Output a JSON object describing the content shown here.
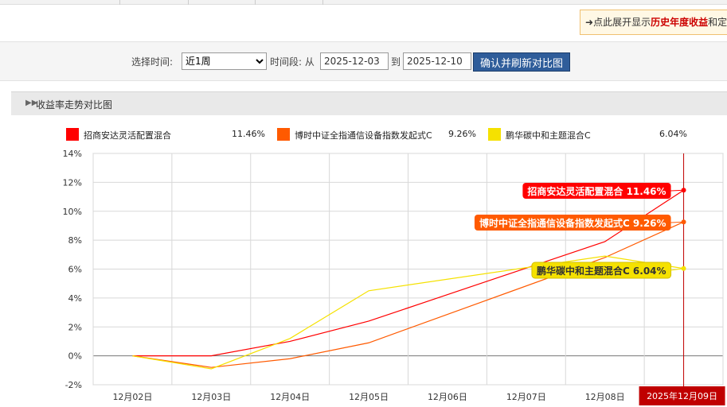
{
  "hint": {
    "text": "点此展开显示",
    "emph": "历史年度收益",
    "tail": "和定"
  },
  "filter": {
    "time_label": "选择时间:",
    "period_selected": "近1周",
    "range_label": "时间段: 从",
    "start_date": "2025-12-03",
    "to_label": "到",
    "end_date": "2025-12-10",
    "confirm_label": "确认并刷新对比图"
  },
  "section": {
    "title": "收益率走势对比图"
  },
  "legend": [
    {
      "name": "招商安达灵活配置混合",
      "value": "11.46%",
      "color": "#ff0000"
    },
    {
      "name": "博时中证全指通信设备指数发起式C",
      "value": "9.26%",
      "color": "#ff5a00"
    },
    {
      "name": "鹏华碳中和主题混合C",
      "value": "6.04%",
      "color": "#f5e100"
    }
  ],
  "chart_data": {
    "type": "line",
    "x": [
      "12月02日",
      "12月03日",
      "12月04日",
      "12月05日",
      "12月06日",
      "12月07日",
      "12月08日",
      "2025年12月09日"
    ],
    "yticks": [
      "14%",
      "12%",
      "10%",
      "8%",
      "6%",
      "4%",
      "2%",
      "0%",
      "-2%"
    ],
    "ylim": [
      -2,
      14
    ],
    "highlight_label": "2025年12月09日",
    "series": [
      {
        "name": "招商安达灵活配置混合",
        "color": "#ff0000",
        "points": [
          [
            "12月02日",
            0
          ],
          [
            "12月03日",
            0
          ],
          [
            "12月04日",
            1.0
          ],
          [
            "12月05日",
            2.4
          ],
          [
            "12月08日",
            7.9
          ],
          [
            "2025年12月09日",
            11.46
          ]
        ],
        "tooltip": "招商安达灵活配置混合 11.46%"
      },
      {
        "name": "博时中证全指通信设备指数发起式C",
        "color": "#ff5a00",
        "points": [
          [
            "12月02日",
            0
          ],
          [
            "12月03日",
            -0.8
          ],
          [
            "12月04日",
            -0.2
          ],
          [
            "12月05日",
            0.9
          ],
          [
            "12月08日",
            6.8
          ],
          [
            "2025年12月09日",
            9.26
          ]
        ],
        "tooltip": "博时中证全指通信设备指数发起式C 9.26%"
      },
      {
        "name": "鹏华碳中和主题混合C",
        "color": "#f5e100",
        "points": [
          [
            "12月02日",
            0
          ],
          [
            "12月03日",
            -0.9
          ],
          [
            "12月04日",
            1.2
          ],
          [
            "12月05日",
            4.5
          ],
          [
            "12月08日",
            6.9
          ],
          [
            "2025年12月09日",
            6.04
          ]
        ],
        "tooltip": "鹏华碳中和主题混合C 6.04%"
      }
    ]
  }
}
